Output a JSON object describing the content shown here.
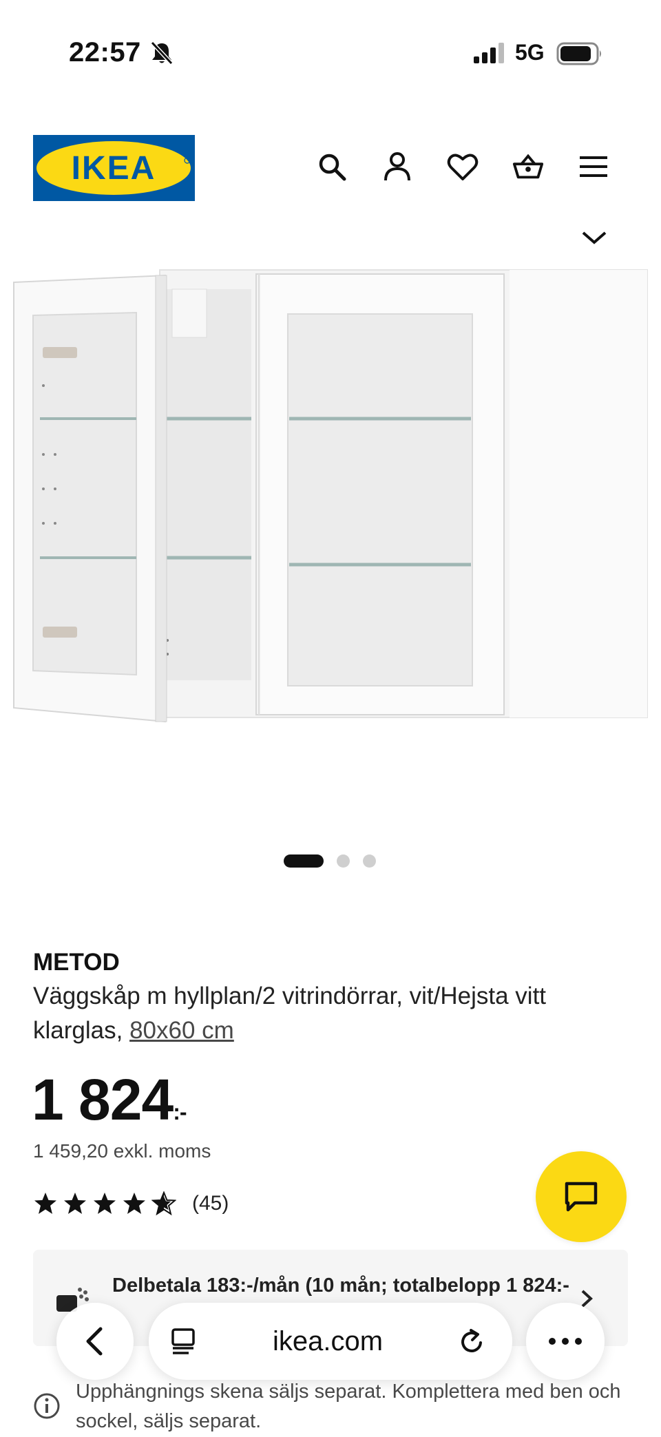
{
  "status_bar": {
    "time": "22:57",
    "network": "5G",
    "icons": [
      "bell-slash-icon",
      "signal-icon",
      "battery-icon"
    ]
  },
  "header": {
    "logo_text": "IKEA",
    "brand_colors": {
      "blue": "#0058a3",
      "yellow": "#fbd914"
    },
    "icons": [
      "search-icon",
      "account-icon",
      "heart-icon",
      "basket-icon",
      "menu-icon",
      "chevron-down-icon"
    ]
  },
  "carousel": {
    "total": 3,
    "active": 1
  },
  "product": {
    "brand": "METOD",
    "description": "Väggskåp m hyllplan/2 vitrindörrar, vit/Hejsta vitt klarglas,",
    "size": "80x60 cm",
    "price": "1 824",
    "price_suffix": ":-",
    "excl_vat": "1 459,20 exkl. moms",
    "rating": 4.5,
    "review_count": "(45)"
  },
  "installment": {
    "text": "Delbetala 183:-/mån (10 mån; totalbelopp 1 824:-"
  },
  "browser": {
    "url": "ikea.com"
  },
  "notice": {
    "text": "Upphängnings skena säljs separat. Komplettera med ben och sockel, säljs separat."
  },
  "colors": {
    "chat_button": "#fbd914",
    "banner_bg": "#f5f5f5"
  }
}
